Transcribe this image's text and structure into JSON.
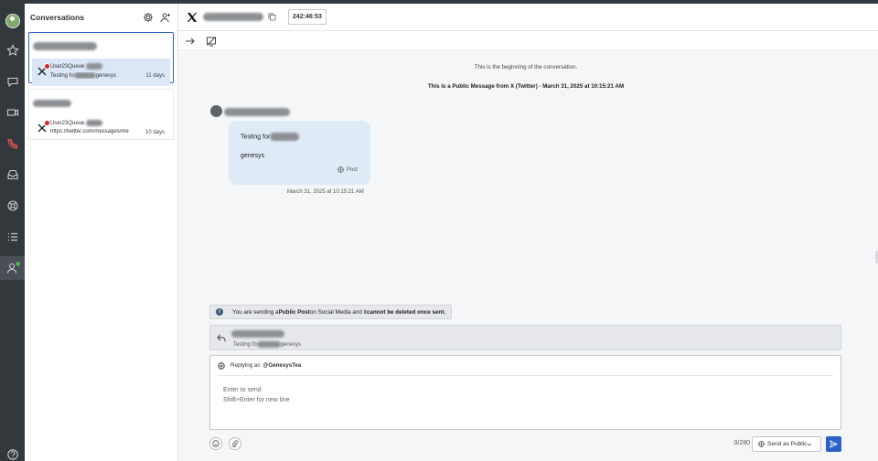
{
  "conversations_panel": {
    "title": "Conversations",
    "items": [
      {
        "user": "User23Queue",
        "preview": "Testing fo",
        "preview_suffix": "genesys",
        "time": "11 days",
        "selected": true
      },
      {
        "user": "User23Queue",
        "preview": "https://twitter.com/messages/me",
        "time": "10 days",
        "selected": false
      }
    ]
  },
  "header": {
    "timer": "242:46:53"
  },
  "chat": {
    "system_start": "This is the beginning of the conversation.",
    "system_public": "This is a Public Message from X (Twitter) · March 31, 2025 at 10:15:21 AM",
    "message": {
      "line1": "Testing for",
      "line2": "genesys",
      "post_label": "Post",
      "timestamp": "March 31, 2025 at 10:15:21 AM"
    }
  },
  "notice": {
    "prefix": "You are sending a ",
    "bold1": "Public Post",
    "middle": " on Social Media and it ",
    "bold2": "cannot be deleted once sent."
  },
  "reply_quote": {
    "text": "Testing fo",
    "suffix": "genesys"
  },
  "composer": {
    "replying_as_label": "Replying as",
    "handle": "@GenesysTea",
    "placeholder_line1": "Enter to send",
    "placeholder_line2": "Shift+Enter for new line",
    "counter": "0/280",
    "send_as": "Send as Public"
  },
  "colors": {
    "accent": "#2a60c9",
    "rail": "#33383d",
    "alert": "#d2252a",
    "bubble": "#dfeaf7"
  }
}
